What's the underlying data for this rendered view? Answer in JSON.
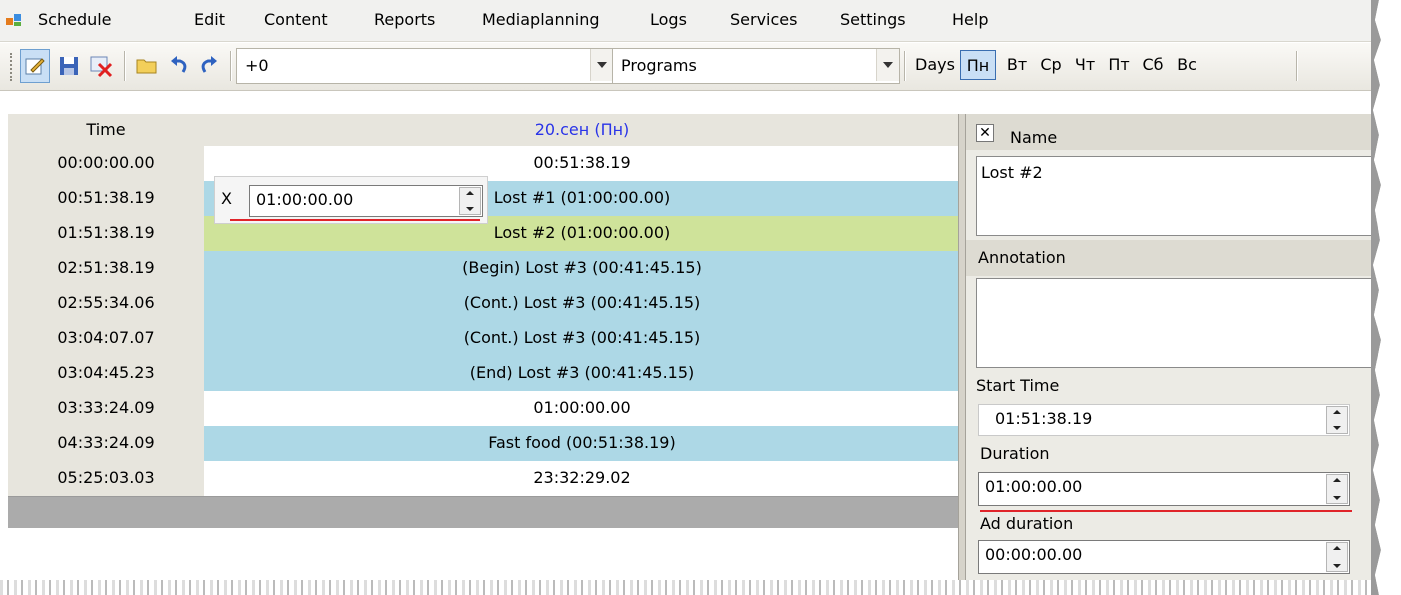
{
  "menu": [
    "Schedule",
    "Edit",
    "Content",
    "Reports",
    "Mediaplanning",
    "Logs",
    "Services",
    "Settings",
    "Help"
  ],
  "toolbar": {
    "offset_value": "+0",
    "view_value": "Programs",
    "days_label": "Days",
    "days": [
      "Пн",
      "Вт",
      "Ср",
      "Чт",
      "Пт",
      "Сб",
      "Вс"
    ],
    "active_day": "Пн"
  },
  "grid": {
    "time_header": "Time",
    "date_header": "20.сен (Пн)",
    "rows": [
      {
        "time": "00:00:00.00",
        "program": "00:51:38.19",
        "type": "gap"
      },
      {
        "time": "00:51:38.19",
        "program": "Lost #1 (01:00:00.00)",
        "type": "program"
      },
      {
        "time": "01:51:38.19",
        "program": "Lost #2 (01:00:00.00)",
        "type": "selected"
      },
      {
        "time": "02:51:38.19",
        "program": "(Begin) Lost #3 (00:41:45.15)",
        "type": "program"
      },
      {
        "time": "02:55:34.06",
        "program": "(Cont.) Lost #3 (00:41:45.15)",
        "type": "program"
      },
      {
        "time": "03:04:07.07",
        "program": "(Cont.) Lost #3 (00:41:45.15)",
        "type": "program"
      },
      {
        "time": "03:04:45.23",
        "program": "(End) Lost #3 (00:41:45.15)",
        "type": "program"
      },
      {
        "time": "03:33:24.09",
        "program": "01:00:00.00",
        "type": "gap"
      },
      {
        "time": "04:33:24.09",
        "program": "Fast food (00:51:38.19)",
        "type": "program"
      },
      {
        "time": "05:25:03.03",
        "program": "23:32:29.02",
        "type": "gap"
      }
    ]
  },
  "editor": {
    "close_label": "X",
    "value": "01:00:00.00"
  },
  "panel": {
    "name_label": "Name",
    "name_value": "Lost #2",
    "annotation_label": "Annotation",
    "annotation_value": "",
    "start_time_label": "Start Time",
    "start_time_value": "01:51:38.19",
    "duration_label": "Duration",
    "duration_value": "01:00:00.00",
    "ad_duration_label": "Ad duration",
    "ad_duration_value": "00:00:00.00"
  },
  "colors": {
    "program_row": "#add8e6",
    "selected_row": "#cfe39a",
    "gap_row": "#ffffff",
    "date_header": "#2a34e8",
    "underline": "#e0242a"
  },
  "icons": [
    "app-icon",
    "edit-icon",
    "save-icon",
    "delete-icon",
    "open-folder-icon",
    "undo-icon",
    "redo-icon",
    "close-icon"
  ]
}
